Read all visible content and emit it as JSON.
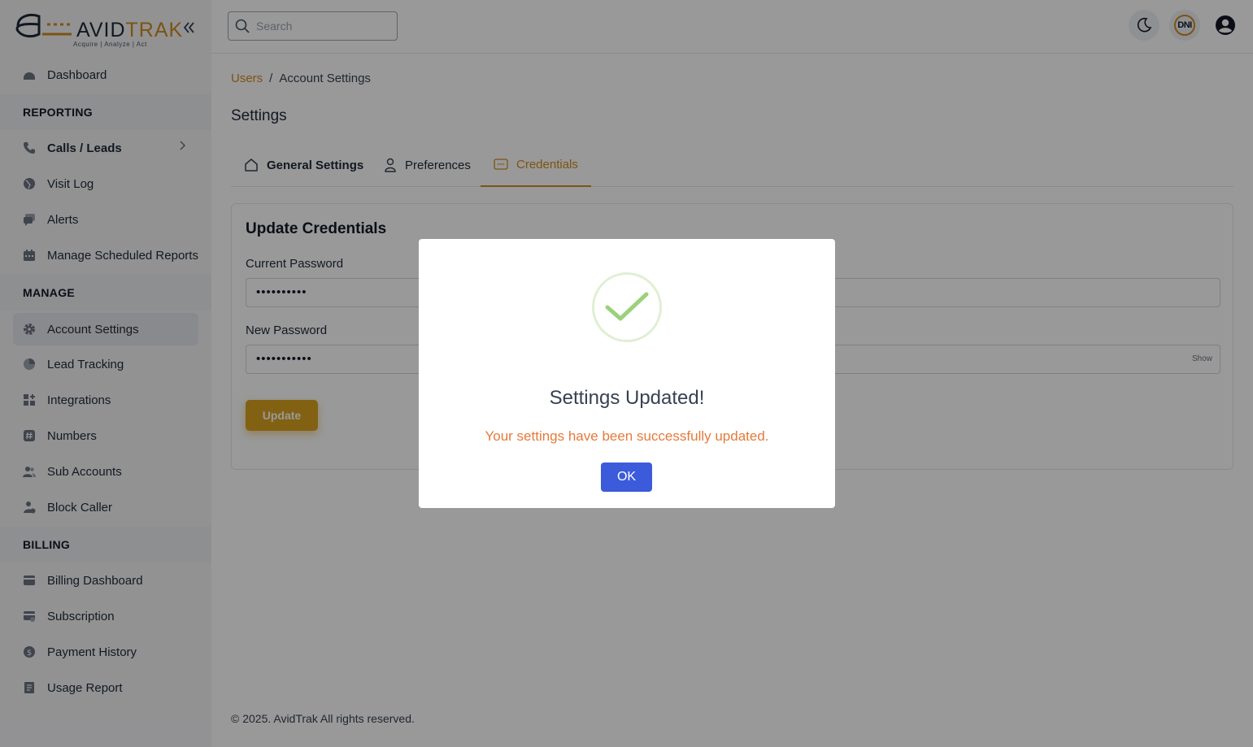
{
  "brand": {
    "name_part1": "AVID",
    "name_part2": "TRAK",
    "tagline": "Acquire | Analyze | Act",
    "accent": "#d08a1e"
  },
  "sidebar": {
    "top_item": {
      "label": "Dashboard",
      "icon": "dashboard-icon"
    },
    "sections": [
      {
        "title": "REPORTING",
        "items": [
          {
            "label": "Calls / Leads",
            "icon": "phone-icon"
          },
          {
            "label": "Visit Log",
            "icon": "globe-icon"
          },
          {
            "label": "Alerts",
            "icon": "chat-icon"
          },
          {
            "label": "Manage Scheduled Reports",
            "icon": "calendar-icon"
          }
        ]
      },
      {
        "title": "MANAGE",
        "items": [
          {
            "label": "Account Settings",
            "icon": "gear-icon"
          },
          {
            "label": "Lead Tracking",
            "icon": "pie-chart-icon"
          },
          {
            "label": "Integrations",
            "icon": "grid-plus-icon"
          },
          {
            "label": "Numbers",
            "icon": "hash-icon"
          },
          {
            "label": "Sub Accounts",
            "icon": "users-icon"
          },
          {
            "label": "Block Caller",
            "icon": "user-block-icon"
          }
        ]
      },
      {
        "title": "BILLING",
        "items": [
          {
            "label": "Billing Dashboard",
            "icon": "credit-card-icon"
          },
          {
            "label": "Subscription",
            "icon": "card-settings-icon"
          },
          {
            "label": "Payment History",
            "icon": "dollar-circle-icon"
          },
          {
            "label": "Usage Report",
            "icon": "report-icon"
          }
        ]
      }
    ]
  },
  "topbar": {
    "search_placeholder": "Search",
    "dni_label": "DNI"
  },
  "breadcrumb": {
    "parent": "Users",
    "separator": "/",
    "current": "Account Settings"
  },
  "page": {
    "title": "Settings",
    "tabs": [
      {
        "label": "General Settings",
        "icon": "home-icon"
      },
      {
        "label": "Preferences",
        "icon": "user-icon"
      },
      {
        "label": "Credentials",
        "icon": "password-icon"
      }
    ]
  },
  "credentials_form": {
    "title": "Update Credentials",
    "current_password_label": "Current Password",
    "current_password_value": "••••••••••",
    "new_password_label": "New Password",
    "new_password_value": "•••••••••••",
    "show_label": "Show",
    "update_label": "Update"
  },
  "footer": {
    "text": "© 2025. AvidTrak All rights reserved."
  },
  "modal": {
    "title": "Settings Updated!",
    "message": "Your settings have been successfully updated.",
    "ok_label": "OK",
    "icon": "success-check-icon"
  }
}
